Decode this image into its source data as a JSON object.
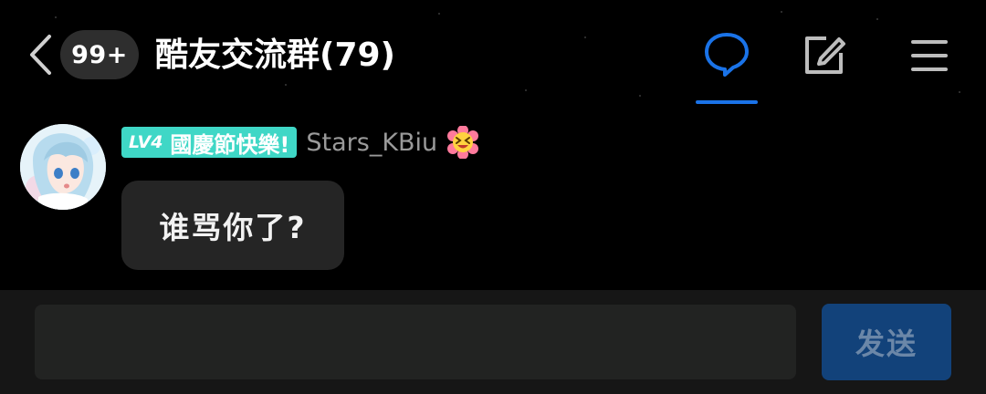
{
  "header": {
    "unread_badge": "99+",
    "title": "酷友交流群(79)",
    "icons": [
      "back-chevron-icon",
      "chat-bubble-icon",
      "edit-icon",
      "menu-icon"
    ],
    "accent_color": "#1a73e8"
  },
  "message": {
    "level": "LV4",
    "honor_title": "國慶節快樂!",
    "honor_color": "#3fd7c6",
    "username": "Stars_KBiu",
    "emoji": "grinning-squint-flower-emoji",
    "text": "谁骂你了?"
  },
  "composer": {
    "input_value": "",
    "input_placeholder": "",
    "send_label": "发送"
  }
}
